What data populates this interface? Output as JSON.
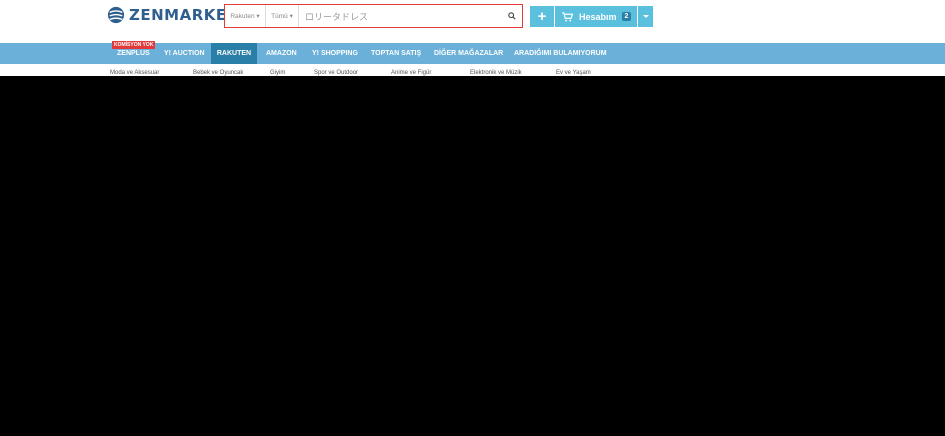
{
  "logo": {
    "text": "ZENMARKET"
  },
  "search": {
    "store": "Rakuten",
    "category": "Tümü",
    "query": "ロリータドレス"
  },
  "account": {
    "add_label": "+",
    "label": "Hesabım",
    "cart_count": "2"
  },
  "nav": {
    "badge": "KOMİSYON YOK",
    "items": [
      "ZENPLUS",
      "Y! AUCTION",
      "RAKUTEN",
      "AMAZON",
      "Y! SHOPPING",
      "TOPTAN SATIŞ",
      "DİĞER MAĞAZALAR",
      "ARADIĞIMI BULAMIYORUM"
    ],
    "active": "RAKUTEN"
  },
  "subcategories": [
    "Moda ve Aksesuar",
    "Bebek ve Oyuncak",
    "Giyim",
    "Spor ve Outdoor",
    "Anime ve Figür",
    "Elektronik ve Müzik",
    "Ev ve Yaşam"
  ],
  "colors": {
    "accent": "#5bc0de",
    "nav": "#6ab0d8",
    "nav_active": "#2a7fa8",
    "search_border": "#e23a3a"
  }
}
